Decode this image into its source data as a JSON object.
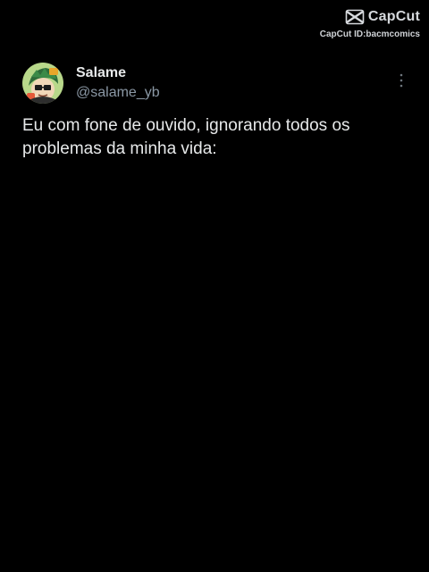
{
  "watermark": {
    "brand": "CapCut",
    "id_text": "CapCut ID:bacmcomics",
    "icon": "capcut-logo-icon"
  },
  "tweet": {
    "display_name": "Salame",
    "handle": "@salame_yb",
    "text": "Eu com fone de ouvido, ignorando todos os problemas da minha vida:",
    "avatar_icon": "avatar-cartoon",
    "more_icon": "more-vertical-icon"
  },
  "colors": {
    "background": "#000000",
    "text_primary": "#e7e9ea",
    "text_secondary": "#8b98a5",
    "avatar_bg": "#b8d88a"
  }
}
